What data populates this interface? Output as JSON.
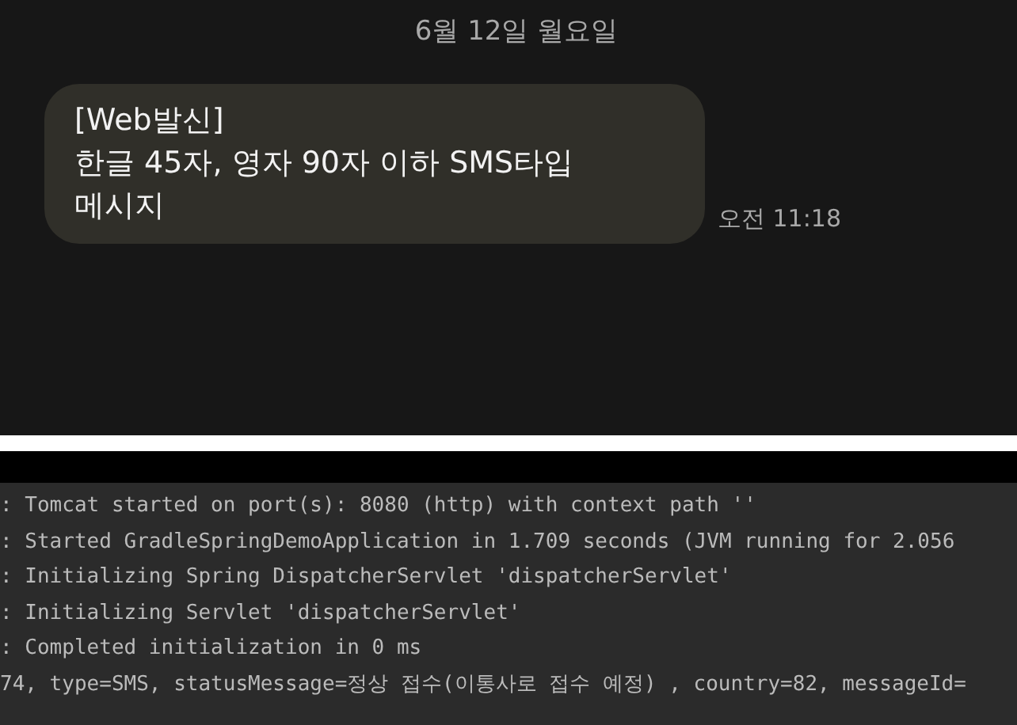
{
  "chat": {
    "date": "6월 12일 월요일",
    "message": {
      "lines": [
        "[Web발신]",
        "한글 45자, 영자 90자 이하 SMS타입",
        "메시지"
      ],
      "time": "오전 11:18"
    }
  },
  "console": {
    "lines": [
      ": Tomcat started on port(s): 8080 (http) with context path ''",
      ": Started GradleSpringDemoApplication in 1.709 seconds (JVM running for 2.056",
      ": Initializing Spring DispatcherServlet 'dispatcherServlet'",
      ": Initializing Servlet 'dispatcherServlet'",
      ": Completed initialization in 0 ms",
      "74, type=SMS, statusMessage=정상 접수(이통사로 접수 예정) , country=82, messageId="
    ]
  }
}
